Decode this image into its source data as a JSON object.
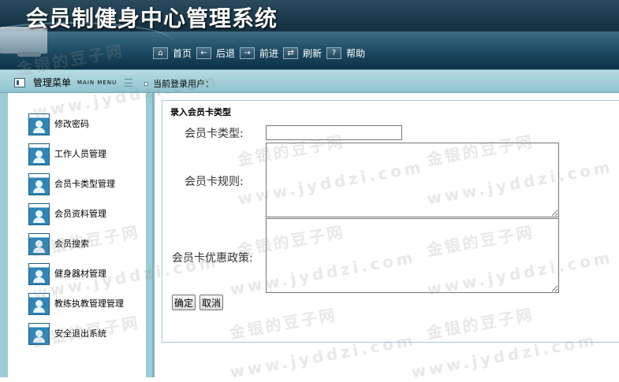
{
  "header": {
    "title": "会员制健身中心管理系统",
    "toolbar": [
      {
        "label": "首页",
        "icon": "home-icon",
        "glyph": "⌂"
      },
      {
        "label": "后退",
        "icon": "back-arrow-icon",
        "glyph": "←"
      },
      {
        "label": "前进",
        "icon": "forward-arrow-icon",
        "glyph": "→"
      },
      {
        "label": "刷新",
        "icon": "refresh-icon",
        "glyph": "⇄"
      },
      {
        "label": "帮助",
        "icon": "help-icon",
        "glyph": "?"
      }
    ]
  },
  "subbar": {
    "menu_title": "管理菜单",
    "menu_title_en": "MAIN MENU",
    "login_label": "当前登录用户："
  },
  "sidebar": {
    "items": [
      {
        "label": "修改密码"
      },
      {
        "label": "工作人员管理"
      },
      {
        "label": "会员卡类型管理"
      },
      {
        "label": "会员资料管理"
      },
      {
        "label": "会员搜索"
      },
      {
        "label": "健身器材管理"
      },
      {
        "label": "教练执教管理管理"
      },
      {
        "label": "安全退出系统"
      }
    ]
  },
  "form": {
    "title": "录入会员卡类型",
    "fields": {
      "card_type": {
        "label": "会员卡类型:",
        "value": ""
      },
      "card_rules": {
        "label": "会员卡规则:",
        "value": ""
      },
      "card_discount": {
        "label": "会员卡优惠政策:",
        "value": ""
      }
    },
    "submit_label": "确定",
    "cancel_label": "取消"
  },
  "watermark": {
    "text_cn": "金银的豆子网",
    "text_url": "www.jyddzi.com"
  },
  "colors": {
    "header_dark": "#153244",
    "header_band": "#1d4c63",
    "subbar": "#a8d2dc",
    "sidebar_border": "#9ccbd7",
    "form_border": "#a9c9d2"
  }
}
